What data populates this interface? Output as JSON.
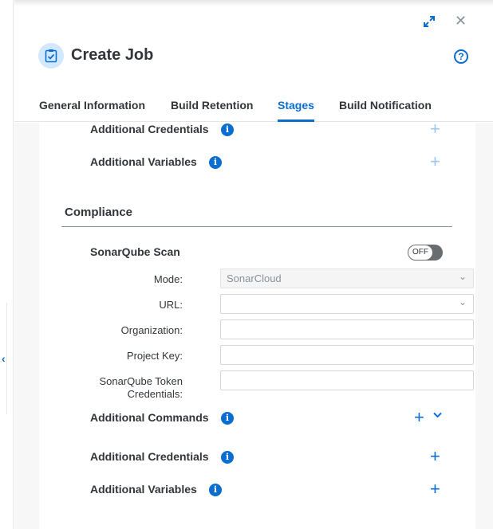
{
  "dialog": {
    "title": "Create Job",
    "icon": "clipboard-check-icon",
    "accent": "#0a6ed1"
  },
  "tabs": [
    {
      "label": "General Information"
    },
    {
      "label": "Build Retention"
    },
    {
      "label": "Stages",
      "active": true
    },
    {
      "label": "Build Notification"
    }
  ],
  "stage_top": {
    "additional_credentials": "Additional Credentials",
    "additional_variables": "Additional Variables"
  },
  "compliance": {
    "title": "Compliance",
    "sonarqube_label": "SonarQube Scan",
    "toggle_text": "OFF",
    "fields": {
      "mode_label": "Mode:",
      "mode_value": "SonarCloud",
      "url_label": "URL:",
      "url_value": "",
      "organization_label": "Organization:",
      "project_key_label": "Project Key:",
      "token_label_line1": "SonarQube Token",
      "token_label_line2": "Credentials:"
    },
    "additional_commands": "Additional Commands",
    "additional_credentials": "Additional Credentials",
    "additional_variables": "Additional Variables"
  },
  "glyphs": {
    "info": "i",
    "plus": "+",
    "close": "✕",
    "help": "?",
    "chevron_down": "⌄",
    "chevron_left": "‹"
  }
}
